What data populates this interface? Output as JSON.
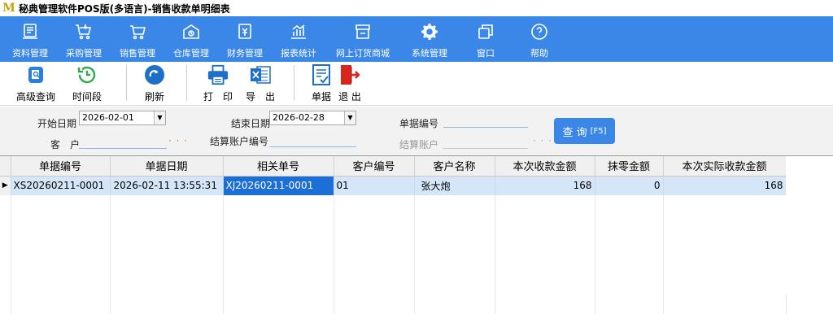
{
  "window": {
    "title": "秘典管理软件POS版(多语言)-销售收款单明细表",
    "logo": "M"
  },
  "menu": [
    {
      "label": "资料管理",
      "icon": "document-icon"
    },
    {
      "label": "采购管理",
      "icon": "cart-icon"
    },
    {
      "label": "销售管理",
      "icon": "trolley-icon"
    },
    {
      "label": "仓库管理",
      "icon": "warehouse-icon"
    },
    {
      "label": "财务管理",
      "icon": "finance-icon"
    },
    {
      "label": "报表统计",
      "icon": "chart-icon"
    },
    {
      "label": "网上订货商城",
      "icon": "store-icon"
    },
    {
      "label": "系统管理",
      "icon": "gear-icon"
    },
    {
      "label": "窗口",
      "icon": "window-icon"
    },
    {
      "label": "帮助",
      "icon": "help-icon"
    }
  ],
  "toolbar": {
    "advanced_query": "高级查询",
    "time_period": "时间段",
    "refresh": "刷新",
    "print": "打　印",
    "export": "导　出",
    "voucher": "单据",
    "exit": "退 出"
  },
  "filter": {
    "start_date_label": "开始日期",
    "start_date": "2026-02-01",
    "end_date_label": "结束日期",
    "end_date": "2026-02-28",
    "doc_no_label": "单据编号",
    "customer_label": "客　户",
    "account_no_label": "结算账户编号",
    "account_label": "结算账户",
    "dots": "· · ·",
    "query_label": "查 询",
    "query_key": "[F5]"
  },
  "grid": {
    "columns": [
      "单据编号",
      "单据日期",
      "相关单号",
      "客户编号",
      "客户名称",
      "本次收款金额",
      "抹零金额",
      "本次实际收款金额"
    ],
    "rows": [
      {
        "doc_no": "XS20260211-0001",
        "date": "2026-02-11 13:55:31",
        "related_no": "XJ20260211-0001",
        "customer_code": "01",
        "customer_name": "张大炮",
        "amount": "168",
        "rounding": "0",
        "actual_amount": "168"
      }
    ]
  },
  "colors": {
    "accent": "#3a87e8",
    "selected_row": "#d5e6f8",
    "highlight_cell": "#1d6fd8"
  }
}
